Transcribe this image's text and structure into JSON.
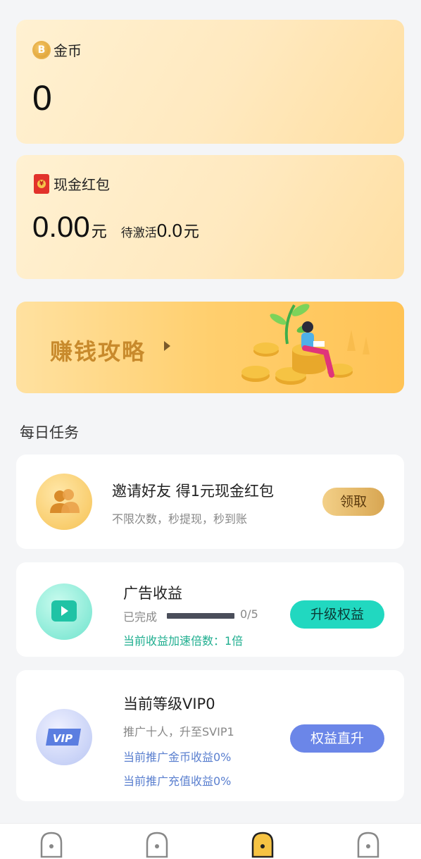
{
  "coin_card": {
    "title": "金币",
    "value": "0"
  },
  "cash_card": {
    "title": "现金红包",
    "amount": "0.00",
    "unit": "元",
    "pending_label": "待激活",
    "pending_value": "0.0",
    "pending_unit": "元"
  },
  "banner": {
    "label": "赚钱攻略"
  },
  "daily_tasks": {
    "title": "每日任务",
    "invite": {
      "title": "邀请好友 得1元现金红包",
      "subtitle": "不限次数，秒提现，秒到账",
      "button": "领取"
    },
    "ads": {
      "title": "广告收益",
      "done_label": "已完成",
      "progress_text": "0/5",
      "progress_fraction": 0,
      "multiplier": "当前收益加速倍数：1倍",
      "button": "升级权益"
    },
    "vip": {
      "title": "当前等级VIP0",
      "subtitle": "推广十人，升至SVIP1",
      "coin_income": "当前推广金币收益0%",
      "recharge_income": "当前推广充值收益0%",
      "button": "权益直升",
      "badge": "VIP"
    }
  },
  "tabbar": {
    "active_index": 2,
    "icons": [
      "tab-icon",
      "tab-icon",
      "tab-icon-active",
      "tab-icon"
    ]
  },
  "colors": {
    "gold_text": "#c88a2c",
    "teal_text": "#1fae8f",
    "blue_text": "#5a7fcf",
    "teal_button": "#21d8c0",
    "blue_button": "#6b86e8"
  }
}
